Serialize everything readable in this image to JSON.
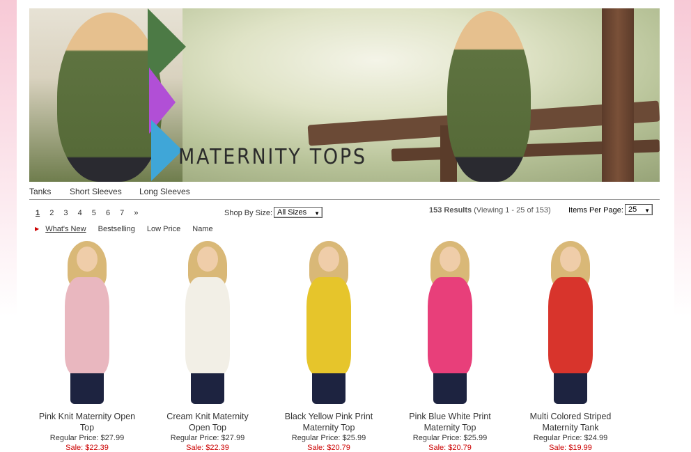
{
  "banner": {
    "title": "MATERNITY TOPS"
  },
  "categories": [
    "Tanks",
    "Short Sleeves",
    "Long Sleeves"
  ],
  "pager": {
    "pages": [
      "1",
      "2",
      "3",
      "4",
      "5",
      "6",
      "7"
    ],
    "next": "»",
    "current": "1"
  },
  "filter": {
    "label": "Shop By Size:",
    "value": "All Sizes"
  },
  "results": {
    "count": "153 Results",
    "viewing": "(Viewing 1 - 25 of 153)"
  },
  "items_per_page": {
    "label": "Items Per Page:",
    "value": "25"
  },
  "sort": {
    "options": [
      "What's New",
      "Bestselling",
      "Low Price",
      "Name"
    ],
    "active": "What's New"
  },
  "products": [
    {
      "name1": "Pink Knit Maternity Open",
      "name2": "Top",
      "regular": "Regular Price: $27.99",
      "sale": "Sale: $22.39",
      "color": "#e9b7bf"
    },
    {
      "name1": "Cream Knit Maternity",
      "name2": "Open Top",
      "regular": "Regular Price: $27.99",
      "sale": "Sale: $22.39",
      "color": "#f2efe6"
    },
    {
      "name1": "Black Yellow Pink Print",
      "name2": "Maternity Top",
      "regular": "Regular Price: $25.99",
      "sale": "Sale: $20.79",
      "color": "#e6c52b"
    },
    {
      "name1": "Pink Blue White Print",
      "name2": "Maternity Top",
      "regular": "Regular Price: $25.99",
      "sale": "Sale: $20.79",
      "color": "#e83f7a"
    },
    {
      "name1": "Multi Colored Striped",
      "name2": "Maternity Tank",
      "regular": "Regular Price: $24.99",
      "sale": "Sale: $19.99",
      "color": "#d8342c"
    }
  ]
}
